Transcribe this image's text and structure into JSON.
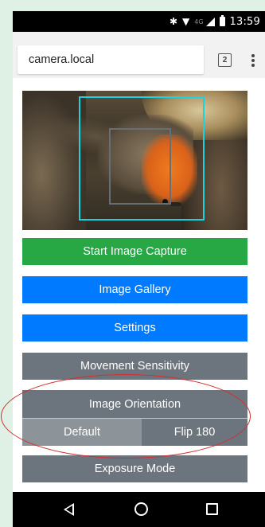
{
  "status_bar": {
    "network": "4G",
    "time": "13:59"
  },
  "browser": {
    "url": "camera.local",
    "tab_count": "2"
  },
  "buttons": {
    "start_capture": "Start Image Capture",
    "gallery": "Image Gallery",
    "settings": "Settings",
    "movement_sensitivity": "Movement Sensitivity",
    "image_orientation": "Image Orientation",
    "orientation_default": "Default",
    "orientation_flip": "Flip 180",
    "exposure_mode": "Exposure Mode"
  },
  "colors": {
    "start_capture": "#28a745",
    "primary": "#007bff",
    "secondary": "#6c757d",
    "detection_box": "#19d4e0",
    "annotation": "#d32f2f"
  },
  "icons": [
    "bluetooth-icon",
    "wifi-icon",
    "signal-icon",
    "battery-icon",
    "tab-switcher-icon",
    "menu-icon",
    "back-icon",
    "home-icon",
    "recents-icon"
  ]
}
